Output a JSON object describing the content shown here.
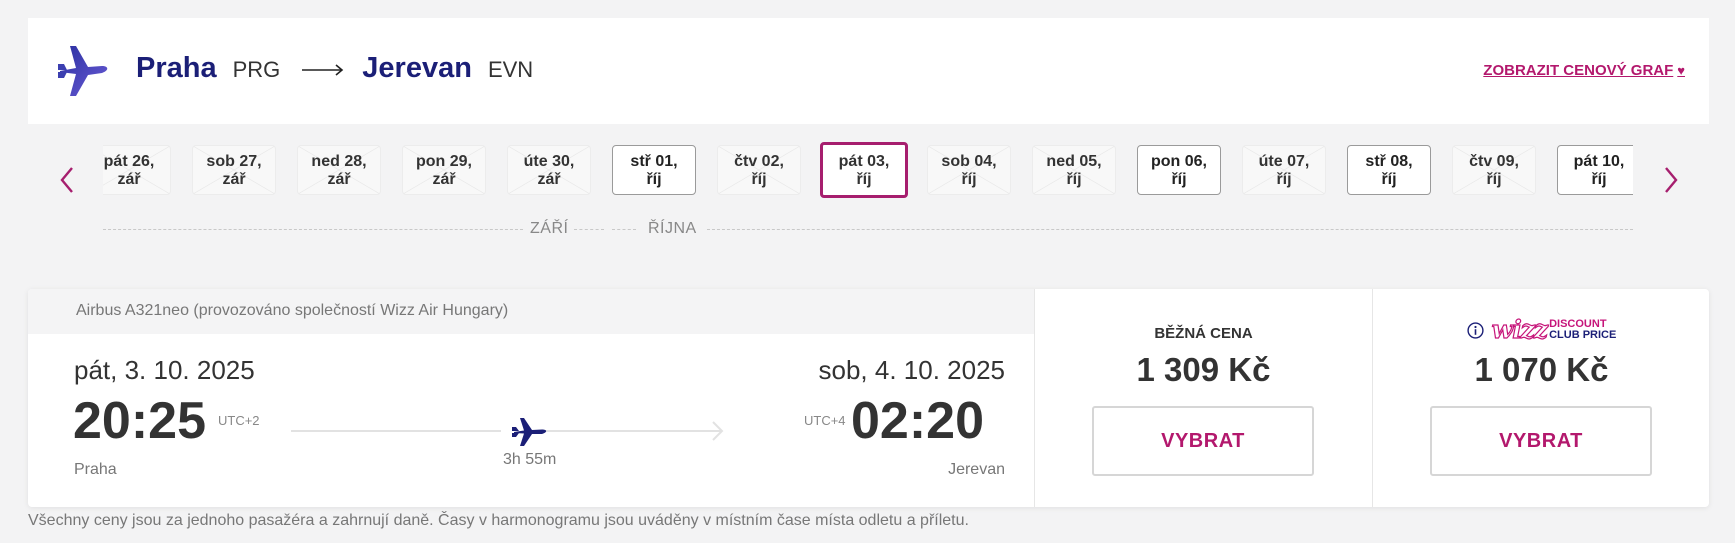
{
  "header": {
    "origin_city": "Praha",
    "origin_code": "PRG",
    "destination_city": "Jerevan",
    "destination_code": "EVN",
    "price_graph_link": "ZOBRAZIT CENOVÝ GRAF",
    "heart_glyph": "♥"
  },
  "dates": [
    {
      "day": "pát 26,",
      "month": "zář",
      "state": "unavailable"
    },
    {
      "day": "sob 27,",
      "month": "zář",
      "state": "unavailable"
    },
    {
      "day": "ned 28,",
      "month": "zář",
      "state": "unavailable"
    },
    {
      "day": "pon 29,",
      "month": "zář",
      "state": "unavailable"
    },
    {
      "day": "úte 30,",
      "month": "zář",
      "state": "unavailable"
    },
    {
      "day": "stř 01,",
      "month": "říj",
      "state": "available"
    },
    {
      "day": "čtv 02,",
      "month": "říj",
      "state": "unavailable"
    },
    {
      "day": "pát 03,",
      "month": "říj",
      "state": "selected"
    },
    {
      "day": "sob 04,",
      "month": "říj",
      "state": "unavailable"
    },
    {
      "day": "ned 05,",
      "month": "říj",
      "state": "unavailable"
    },
    {
      "day": "pon 06,",
      "month": "říj",
      "state": "available"
    },
    {
      "day": "úte 07,",
      "month": "říj",
      "state": "unavailable"
    },
    {
      "day": "stř 08,",
      "month": "říj",
      "state": "available"
    },
    {
      "day": "čtv 09,",
      "month": "říj",
      "state": "unavailable"
    },
    {
      "day": "pát 10,",
      "month": "říj",
      "state": "available"
    }
  ],
  "months": {
    "first": "ZÁŘÍ",
    "second": "ŘÍJNA"
  },
  "flight": {
    "aircraft": "Airbus A321neo (provozováno společností Wizz Air Hungary)",
    "departure_date": "pát, 3. 10. 2025",
    "arrival_date": "sob, 4. 10. 2025",
    "departure_time": "20:25",
    "arrival_time": "02:20",
    "departure_utc": "UTC+2",
    "arrival_utc": "UTC+4",
    "duration": "3h 55m",
    "departure_city": "Praha",
    "arrival_city": "Jerevan"
  },
  "fares": {
    "regular_label": "BĚŽNÁ CENA",
    "regular_price": "1 309 Kč",
    "club_logo": "wizz",
    "club_line1": "DISCOUNT",
    "club_line2": "CLUB PRICE",
    "club_price": "1 070 Kč",
    "select_label": "VYBRAT"
  },
  "disclaimer": "Všechny ceny jsou za jednoho pasažéra a zahrnují daně. Časy v harmonogramu jsou uváděny v místním čase místa odletu a příletu.",
  "colors": {
    "brand_navy": "#1b1f77",
    "accent_magenta": "#b3186d",
    "selected_border": "#a61e6e"
  }
}
